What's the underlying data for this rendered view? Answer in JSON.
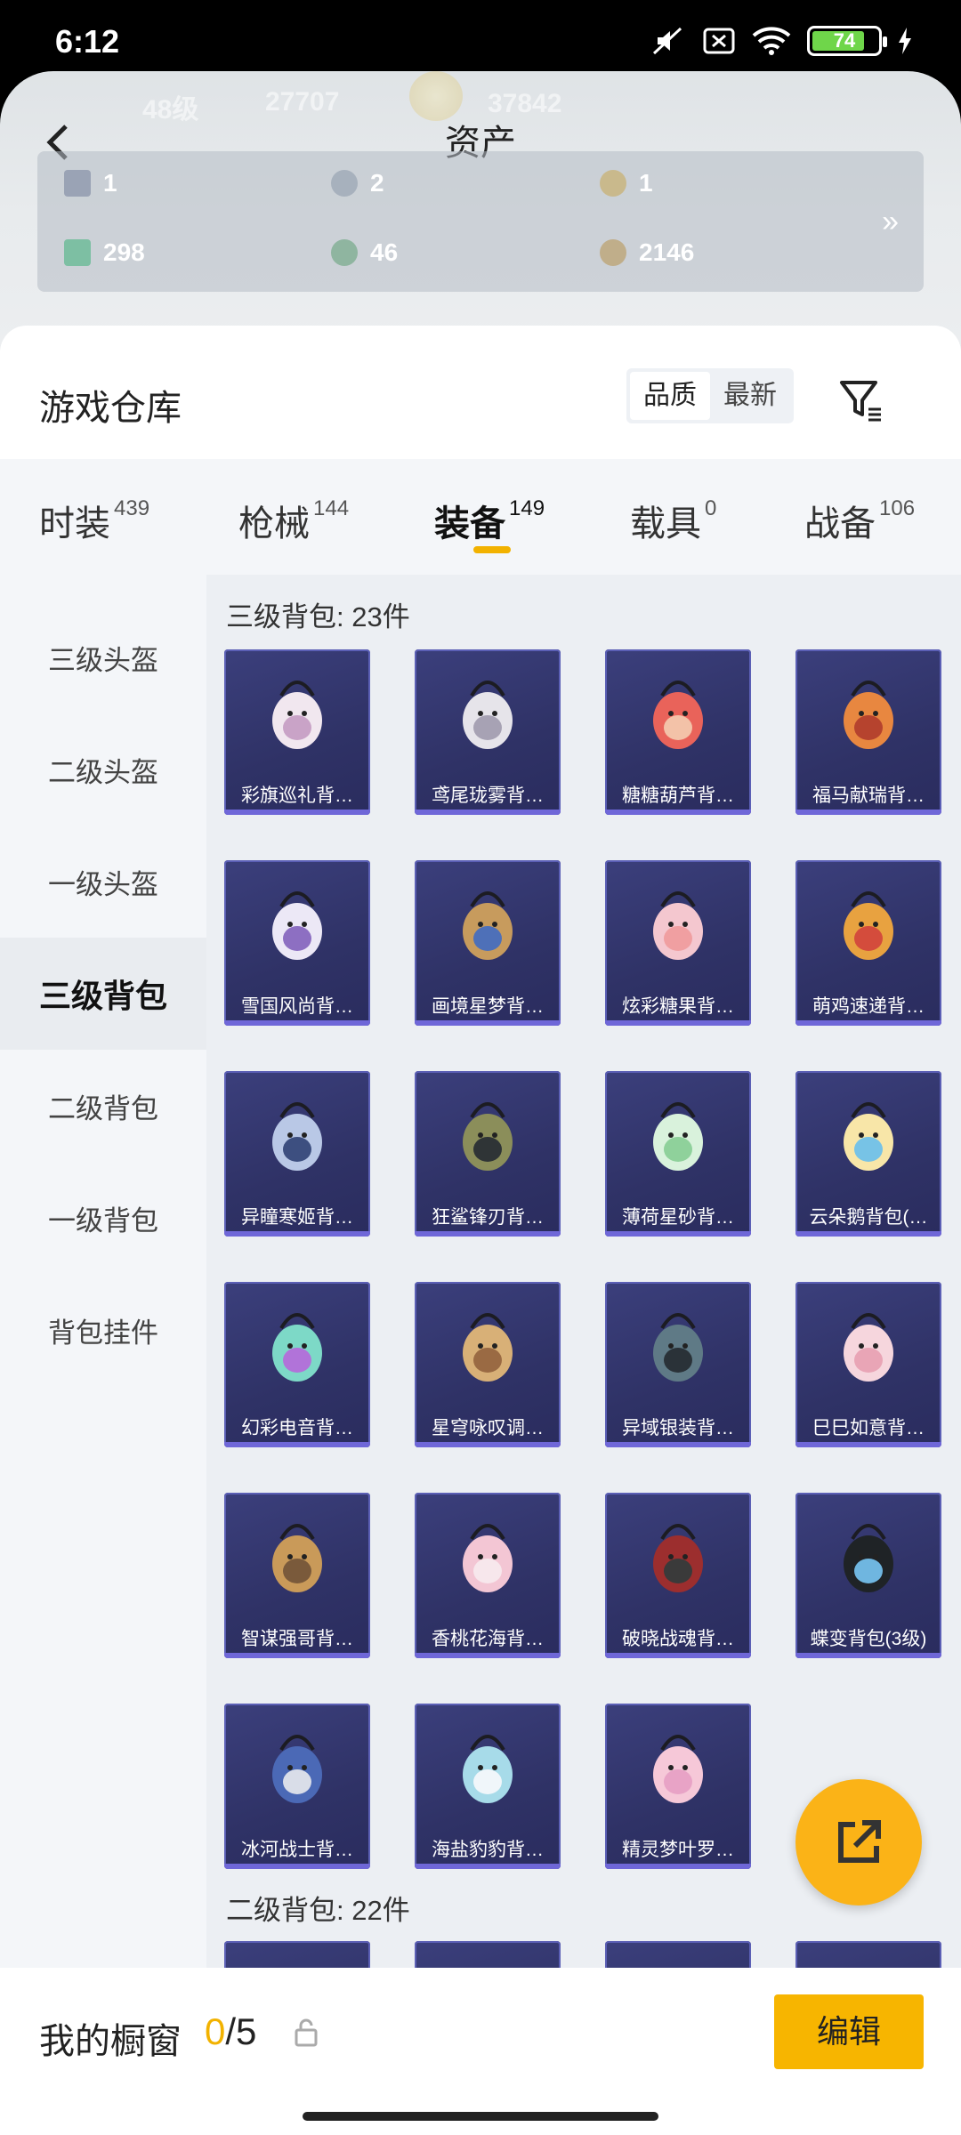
{
  "status_bar": {
    "time": "6:12",
    "battery": "74"
  },
  "header": {
    "title": "资产",
    "faded_stats": [
      "48级",
      "27707",
      "37842"
    ],
    "assets": [
      {
        "value": "1",
        "icon": "card-icon"
      },
      {
        "value": "2",
        "icon": "coin-icon"
      },
      {
        "value": "1",
        "icon": "badge-icon"
      },
      {
        "value": "298",
        "icon": "gem-icon"
      },
      {
        "value": "46",
        "icon": "orb-icon"
      },
      {
        "value": "2146",
        "icon": "token-icon"
      }
    ],
    "more_glyph": "»"
  },
  "warehouse": {
    "title": "游戏仓库",
    "sort_options": [
      "品质",
      "最新"
    ]
  },
  "tabs": [
    {
      "label": "时装",
      "count": "439"
    },
    {
      "label": "枪械",
      "count": "144"
    },
    {
      "label": "装备",
      "count": "149",
      "active": true
    },
    {
      "label": "载具",
      "count": "0"
    },
    {
      "label": "战备",
      "count": "106"
    }
  ],
  "sidebar": [
    "三级头盔",
    "二级头盔",
    "一级头盔",
    "三级背包",
    "二级背包",
    "一级背包",
    "背包挂件"
  ],
  "sections": [
    {
      "title": "三级背包: 23件",
      "items": [
        "彩旗巡礼背…",
        "鸢尾珑雾背…",
        "糖糖葫芦背…",
        "福马献瑞背…",
        "雪国风尚背…",
        "画境星梦背…",
        "炫彩糖果背…",
        "萌鸡速递背…",
        "异瞳寒姬背…",
        "狂鲨锋刃背…",
        "薄荷星砂背…",
        "云朵鹅背包(…",
        "幻彩电音背…",
        "星穹咏叹调…",
        "异域银装背…",
        "巳巳如意背…",
        "智谋强哥背…",
        "香桃花海背…",
        "破晓战魂背…",
        "蝶变背包(3级)",
        "冰河战士背…",
        "海盐豹豹背…",
        "精灵梦叶罗…"
      ]
    },
    {
      "title": "二级背包: 22件"
    }
  ],
  "bottom": {
    "label": "我的橱窗",
    "count_used": "0",
    "count_total": "/5",
    "edit": "编辑"
  },
  "colors": {
    "accent": "#f2b200",
    "card_bg": "#2f3266",
    "fab": "#fbb317"
  }
}
